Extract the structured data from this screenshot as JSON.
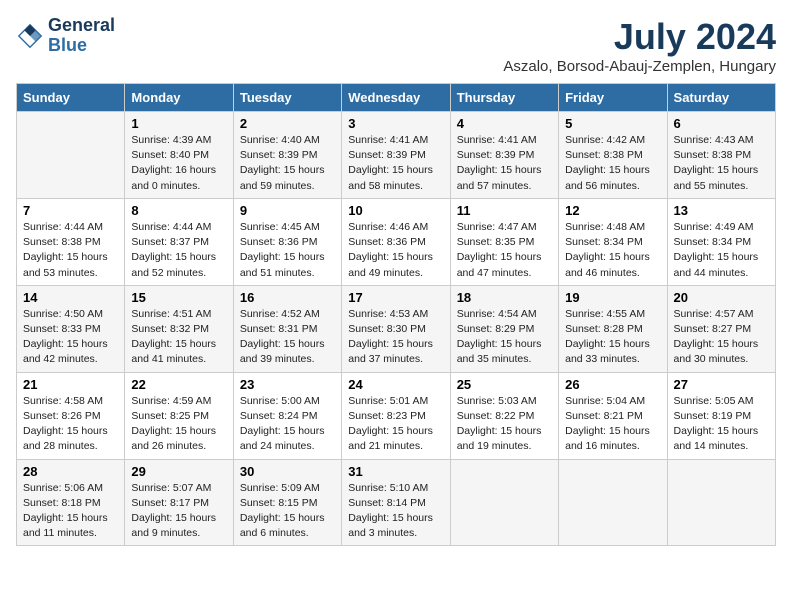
{
  "logo": {
    "line1": "General",
    "line2": "Blue"
  },
  "title": "July 2024",
  "location": "Aszalo, Borsod-Abauj-Zemplen, Hungary",
  "days_of_week": [
    "Sunday",
    "Monday",
    "Tuesday",
    "Wednesday",
    "Thursday",
    "Friday",
    "Saturday"
  ],
  "weeks": [
    [
      {
        "day": "",
        "content": ""
      },
      {
        "day": "1",
        "content": "Sunrise: 4:39 AM\nSunset: 8:40 PM\nDaylight: 16 hours\nand 0 minutes."
      },
      {
        "day": "2",
        "content": "Sunrise: 4:40 AM\nSunset: 8:39 PM\nDaylight: 15 hours\nand 59 minutes."
      },
      {
        "day": "3",
        "content": "Sunrise: 4:41 AM\nSunset: 8:39 PM\nDaylight: 15 hours\nand 58 minutes."
      },
      {
        "day": "4",
        "content": "Sunrise: 4:41 AM\nSunset: 8:39 PM\nDaylight: 15 hours\nand 57 minutes."
      },
      {
        "day": "5",
        "content": "Sunrise: 4:42 AM\nSunset: 8:38 PM\nDaylight: 15 hours\nand 56 minutes."
      },
      {
        "day": "6",
        "content": "Sunrise: 4:43 AM\nSunset: 8:38 PM\nDaylight: 15 hours\nand 55 minutes."
      }
    ],
    [
      {
        "day": "7",
        "content": "Sunrise: 4:44 AM\nSunset: 8:38 PM\nDaylight: 15 hours\nand 53 minutes."
      },
      {
        "day": "8",
        "content": "Sunrise: 4:44 AM\nSunset: 8:37 PM\nDaylight: 15 hours\nand 52 minutes."
      },
      {
        "day": "9",
        "content": "Sunrise: 4:45 AM\nSunset: 8:36 PM\nDaylight: 15 hours\nand 51 minutes."
      },
      {
        "day": "10",
        "content": "Sunrise: 4:46 AM\nSunset: 8:36 PM\nDaylight: 15 hours\nand 49 minutes."
      },
      {
        "day": "11",
        "content": "Sunrise: 4:47 AM\nSunset: 8:35 PM\nDaylight: 15 hours\nand 47 minutes."
      },
      {
        "day": "12",
        "content": "Sunrise: 4:48 AM\nSunset: 8:34 PM\nDaylight: 15 hours\nand 46 minutes."
      },
      {
        "day": "13",
        "content": "Sunrise: 4:49 AM\nSunset: 8:34 PM\nDaylight: 15 hours\nand 44 minutes."
      }
    ],
    [
      {
        "day": "14",
        "content": "Sunrise: 4:50 AM\nSunset: 8:33 PM\nDaylight: 15 hours\nand 42 minutes."
      },
      {
        "day": "15",
        "content": "Sunrise: 4:51 AM\nSunset: 8:32 PM\nDaylight: 15 hours\nand 41 minutes."
      },
      {
        "day": "16",
        "content": "Sunrise: 4:52 AM\nSunset: 8:31 PM\nDaylight: 15 hours\nand 39 minutes."
      },
      {
        "day": "17",
        "content": "Sunrise: 4:53 AM\nSunset: 8:30 PM\nDaylight: 15 hours\nand 37 minutes."
      },
      {
        "day": "18",
        "content": "Sunrise: 4:54 AM\nSunset: 8:29 PM\nDaylight: 15 hours\nand 35 minutes."
      },
      {
        "day": "19",
        "content": "Sunrise: 4:55 AM\nSunset: 8:28 PM\nDaylight: 15 hours\nand 33 minutes."
      },
      {
        "day": "20",
        "content": "Sunrise: 4:57 AM\nSunset: 8:27 PM\nDaylight: 15 hours\nand 30 minutes."
      }
    ],
    [
      {
        "day": "21",
        "content": "Sunrise: 4:58 AM\nSunset: 8:26 PM\nDaylight: 15 hours\nand 28 minutes."
      },
      {
        "day": "22",
        "content": "Sunrise: 4:59 AM\nSunset: 8:25 PM\nDaylight: 15 hours\nand 26 minutes."
      },
      {
        "day": "23",
        "content": "Sunrise: 5:00 AM\nSunset: 8:24 PM\nDaylight: 15 hours\nand 24 minutes."
      },
      {
        "day": "24",
        "content": "Sunrise: 5:01 AM\nSunset: 8:23 PM\nDaylight: 15 hours\nand 21 minutes."
      },
      {
        "day": "25",
        "content": "Sunrise: 5:03 AM\nSunset: 8:22 PM\nDaylight: 15 hours\nand 19 minutes."
      },
      {
        "day": "26",
        "content": "Sunrise: 5:04 AM\nSunset: 8:21 PM\nDaylight: 15 hours\nand 16 minutes."
      },
      {
        "day": "27",
        "content": "Sunrise: 5:05 AM\nSunset: 8:19 PM\nDaylight: 15 hours\nand 14 minutes."
      }
    ],
    [
      {
        "day": "28",
        "content": "Sunrise: 5:06 AM\nSunset: 8:18 PM\nDaylight: 15 hours\nand 11 minutes."
      },
      {
        "day": "29",
        "content": "Sunrise: 5:07 AM\nSunset: 8:17 PM\nDaylight: 15 hours\nand 9 minutes."
      },
      {
        "day": "30",
        "content": "Sunrise: 5:09 AM\nSunset: 8:15 PM\nDaylight: 15 hours\nand 6 minutes."
      },
      {
        "day": "31",
        "content": "Sunrise: 5:10 AM\nSunset: 8:14 PM\nDaylight: 15 hours\nand 3 minutes."
      },
      {
        "day": "",
        "content": ""
      },
      {
        "day": "",
        "content": ""
      },
      {
        "day": "",
        "content": ""
      }
    ]
  ]
}
